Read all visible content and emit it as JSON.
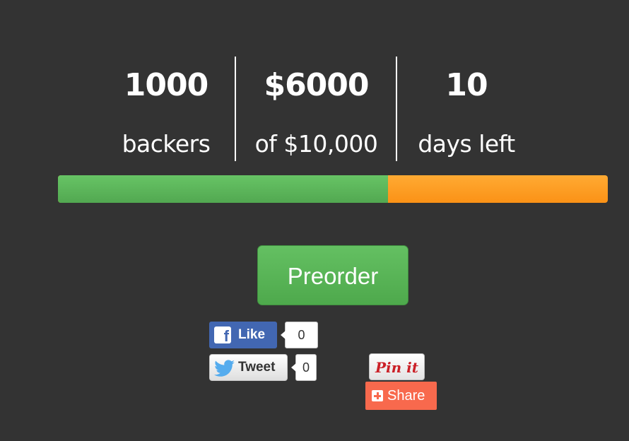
{
  "stats": {
    "backers": {
      "value": "1000",
      "label": "backers"
    },
    "pledged": {
      "value": "$6000",
      "label": "of $10,000"
    },
    "days": {
      "value": "10",
      "label": "days left"
    }
  },
  "progress": {
    "funded_fraction": 0.6,
    "fill_color": "#5cb85c",
    "remaining_color": "#fb9a21"
  },
  "preorder": {
    "label": "Preorder",
    "color": "#5cb85c"
  },
  "social": {
    "facebook": {
      "label": "Like",
      "count": "0",
      "icon": "facebook-icon",
      "color": "#4267b2"
    },
    "twitter": {
      "label": "Tweet",
      "count": "0",
      "icon": "twitter-bird-icon"
    },
    "pinterest": {
      "label": "Pin it"
    },
    "share": {
      "label": "Share",
      "icon": "plus-icon",
      "color": "#f8694d"
    }
  }
}
